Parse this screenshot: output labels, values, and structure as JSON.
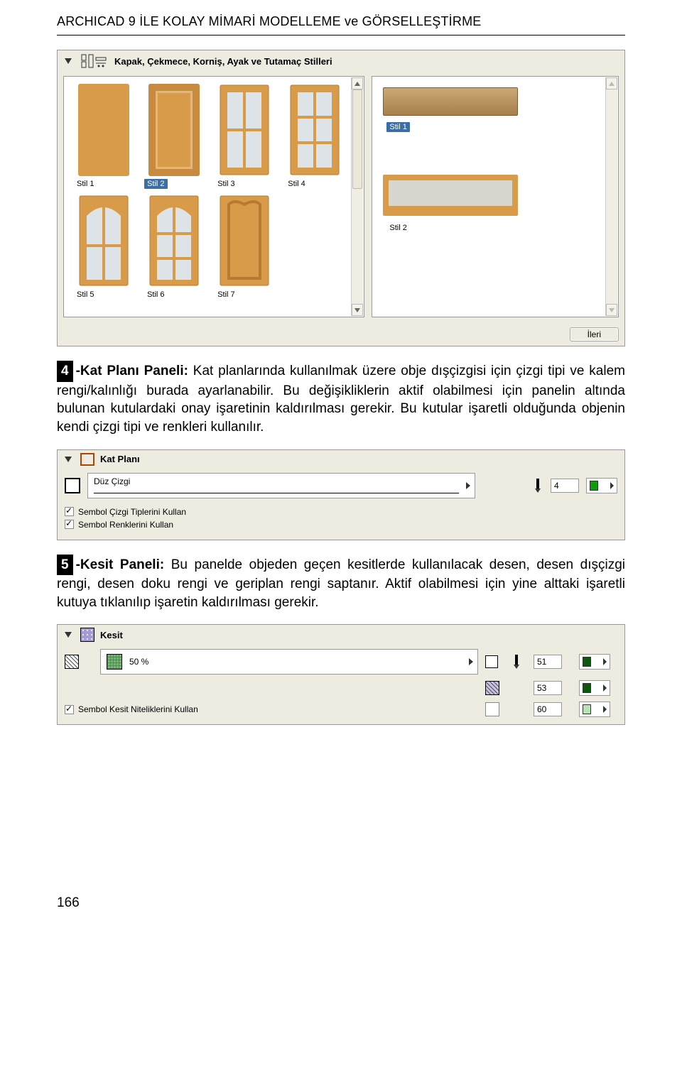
{
  "pageHeader": "ARCHICAD 9 İLE KOLAY MİMARİ MODELLEME ve GÖRSELLEŞTİRME",
  "panels": {
    "styles": {
      "title": "Kapak, Çekmece, Korniş, Ayak ve Tutamaç Stilleri",
      "left": [
        {
          "label": "Stil 1",
          "selected": false
        },
        {
          "label": "Stil 2",
          "selected": true
        },
        {
          "label": "Stil 3",
          "selected": false
        },
        {
          "label": "Stil 4",
          "selected": false
        },
        {
          "label": "Stil 5",
          "selected": false
        },
        {
          "label": "Stil 6",
          "selected": false
        },
        {
          "label": "Stil 7",
          "selected": false
        }
      ],
      "right": [
        {
          "label": "Stil 1",
          "selected": true
        },
        {
          "label": "Stil 2",
          "selected": false
        }
      ],
      "footerButton": "İleri"
    },
    "katplani": {
      "title": "Kat Planı",
      "lineTypeName": "Düz Çizgi",
      "penValue": "4",
      "checkboxes": {
        "cizgitipleri": "Sembol Çizgi Tiplerini Kullan",
        "renkleri": "Sembol Renklerini Kullan"
      }
    },
    "kesit": {
      "title": "Kesit",
      "patternName": "50 %",
      "rows": [
        {
          "pen": "51",
          "color": "#0b5a0b"
        },
        {
          "pen": "53",
          "color": "#0b5a0b"
        },
        {
          "pen": "60",
          "color": "#b7e3b7"
        }
      ],
      "checkbox": "Sembol Kesit Niteliklerini Kullan"
    }
  },
  "paragraphs": {
    "p4_num": "4",
    "p4_bold": "-Kat Planı Paneli:",
    "p4_text": " Kat planlarında kullanılmak üzere obje dışçizgisi için çizgi tipi ve kalem rengi/kalınlığı burada ayarlanabilir. Bu değişikliklerin aktif olabilmesi için panelin altında bulunan kutulardaki onay işaretinin kaldırılması gerekir. Bu kutular işaretli olduğunda objenin kendi çizgi tipi ve renkleri kullanılır.",
    "p5_num": "5",
    "p5_bold": "-Kesit Paneli:",
    "p5_text": " Bu panelde objeden geçen kesitlerde kullanılacak desen, desen dışçizgi rengi, desen doku rengi ve geriplan rengi saptanır. Aktif olabilmesi için yine alttaki işaretli kutuya tıklanılıp işaretin kaldırılması gerekir."
  },
  "pageNumber": "166"
}
